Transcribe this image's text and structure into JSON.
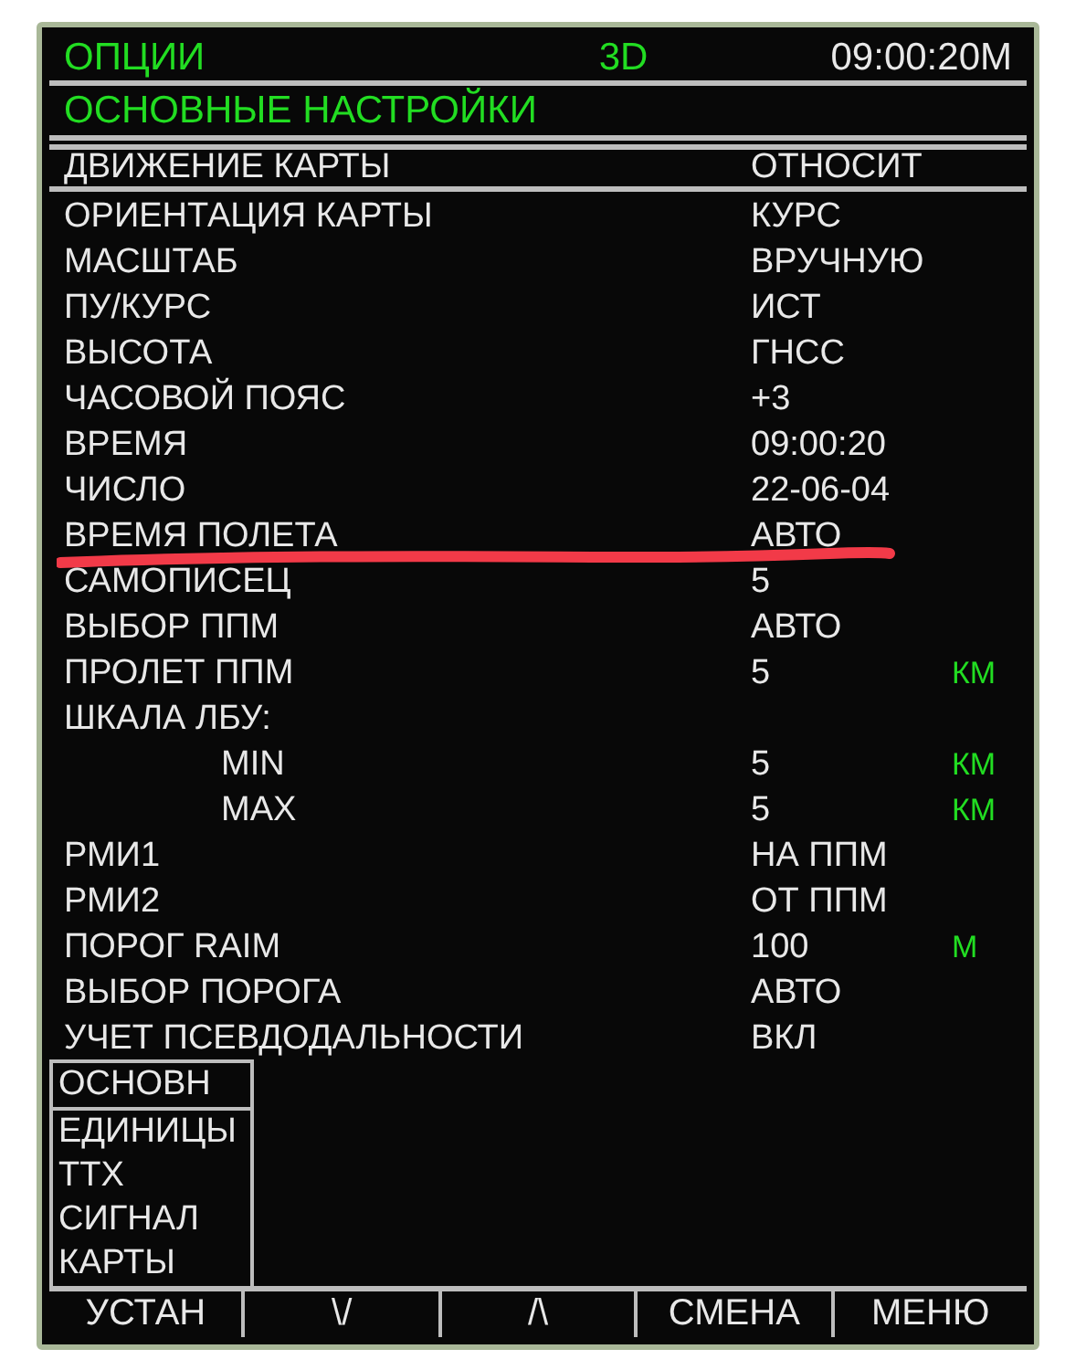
{
  "header": {
    "page": "ОПЦИИ",
    "mode": "3D",
    "time": "09:00:20М"
  },
  "title": "ОСНОВНЫЕ НАСТРОЙКИ",
  "rows": [
    {
      "label": "ДВИЖЕНИЕ КАРТЫ",
      "value": "ОТНОСИТ",
      "selected": true
    },
    {
      "label": "ОРИЕНТАЦИЯ КАРТЫ",
      "value": "КУРС",
      "selected": false
    },
    {
      "label": "МАСШТАБ",
      "value": "ВРУЧНУЮ",
      "selected": false
    },
    {
      "label": "ПУ/КУРС",
      "value": "ИСТ",
      "selected": false
    },
    {
      "label": "ВЫСОТА",
      "value": "ГНСС",
      "selected": false
    },
    {
      "label": "ЧАСОВОЙ ПОЯС",
      "value": "+3",
      "selected": false
    },
    {
      "label": "ВРЕМЯ",
      "value": "09:00:20",
      "selected": false
    },
    {
      "label": "ЧИСЛО",
      "value": "22-06-04",
      "selected": false
    },
    {
      "label": "ВРЕМЯ ПОЛЕТА",
      "value": "АВТО",
      "selected": false,
      "marked": true
    },
    {
      "label": "САМОПИСЕЦ",
      "value": "5",
      "selected": false
    },
    {
      "label": "ВЫБОР ППМ",
      "value": "АВТО",
      "selected": false
    },
    {
      "label": "ПРОЛЕТ ППМ",
      "value": "5",
      "unit": "КМ",
      "selected": false
    },
    {
      "label": "ШКАЛА ЛБУ:",
      "selected": false,
      "children": [
        {
          "label": "MIN",
          "value": "5",
          "unit": "КМ",
          "selected": false
        },
        {
          "label": "MAX",
          "value": "5",
          "unit": "КМ",
          "selected": false
        }
      ]
    },
    {
      "label": "РМИ1",
      "value": "НА ППМ",
      "selected": false
    },
    {
      "label": "РМИ2",
      "value": "ОТ ППМ",
      "selected": false
    },
    {
      "label": "ПОРОГ RAIM",
      "value": "100",
      "unit": "М",
      "selected": false
    },
    {
      "label": "ВЫБОР ПОРОГА",
      "value": "АВТО",
      "selected": false
    },
    {
      "label": "УЧЕТ ПСЕВДОДАЛЬНОСТИ",
      "value": "ВКЛ",
      "selected": false
    }
  ],
  "menu": [
    {
      "label": "ОСНОВН",
      "selected": true
    },
    {
      "label": "ЕДИНИЦЫ",
      "selected": false
    },
    {
      "label": "ТТХ",
      "selected": false
    },
    {
      "label": "СИГНАЛ",
      "selected": false
    },
    {
      "label": "КАРТЫ",
      "selected": false
    }
  ],
  "softkeys": [
    "УСТАН",
    "\\/",
    "/\\",
    "СМЕНА",
    "МЕНЮ"
  ]
}
